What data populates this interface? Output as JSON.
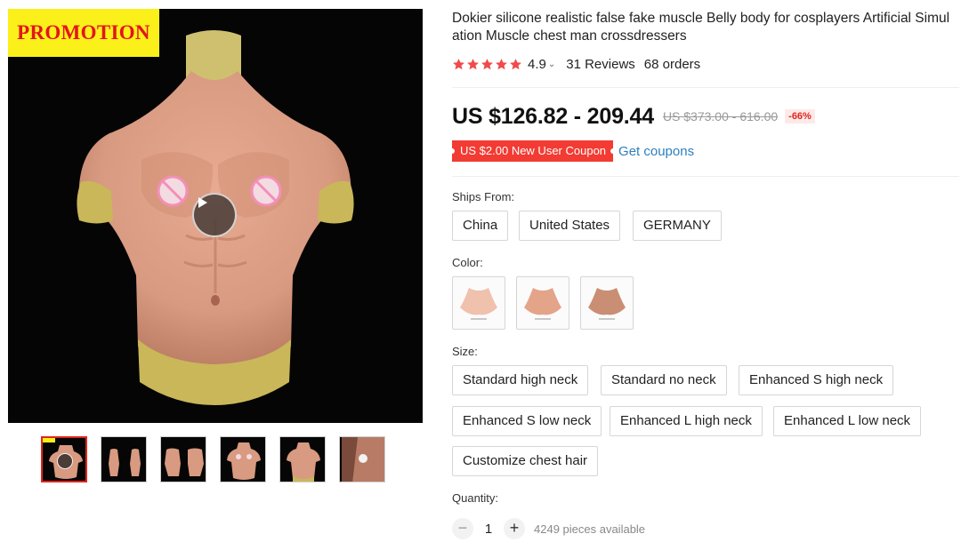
{
  "gallery": {
    "promo_badge": "PROMOTION",
    "thumbnail_count": 6,
    "selected_thumbnail": 1
  },
  "product": {
    "title": "Dokier silicone realistic false fake muscle Belly body for cosplayers Artificial Simulation Muscle chest man crossdressers",
    "rating": "4.9",
    "stars": 5,
    "reviews": "31 Reviews",
    "orders": "68 orders",
    "price": "US $126.82 - 209.44",
    "original_price": "US $373.00 - 616.00",
    "discount": "-66%",
    "coupon": "US $2.00 New User Coupon",
    "get_coupons": "Get coupons"
  },
  "ships_from": {
    "label": "Ships From:",
    "options": [
      "China",
      "United States",
      "GERMANY"
    ]
  },
  "color": {
    "label": "Color:",
    "swatches": [
      "color-1",
      "color-2",
      "color-3"
    ]
  },
  "size": {
    "label": "Size:",
    "options": [
      "Standard high neck",
      "Standard no neck",
      "Enhanced S high neck",
      "Enhanced S low neck",
      "Enhanced L high neck",
      "Enhanced L low neck",
      "Customize chest hair"
    ]
  },
  "quantity": {
    "label": "Quantity:",
    "value": "1",
    "minus": "−",
    "plus": "+",
    "available": "4249 pieces available"
  },
  "colors": {
    "accent_red": "#e1251b",
    "coupon_red": "#f23b33",
    "link_blue": "#2e7fbf",
    "promo_yellow": "#fbf01a",
    "star_red": "#f04a4a"
  }
}
